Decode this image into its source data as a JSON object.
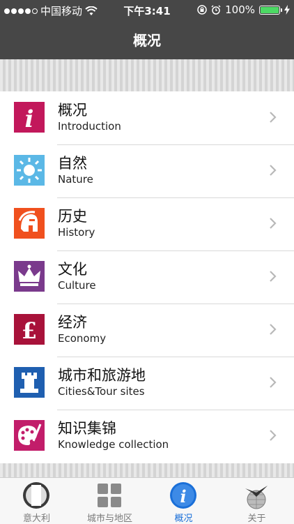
{
  "status_bar": {
    "carrier": "中国移动",
    "time": "下午3:41",
    "battery": "100%",
    "battery_level": 1.0
  },
  "nav": {
    "title": "概况"
  },
  "menu": {
    "items": [
      {
        "zh": "概况",
        "en": "Introduction",
        "icon": "info-icon",
        "color": "#c2185b"
      },
      {
        "zh": "自然",
        "en": "Nature",
        "icon": "sun-icon",
        "color": "#5bb8e6"
      },
      {
        "zh": "历史",
        "en": "History",
        "icon": "spartan-helmet-icon",
        "color": "#f0501e"
      },
      {
        "zh": "文化",
        "en": "Culture",
        "icon": "crown-icon",
        "color": "#7a3a8c"
      },
      {
        "zh": "经济",
        "en": "Economy",
        "icon": "pound-icon",
        "color": "#a8123a"
      },
      {
        "zh": "城市和旅游地",
        "en": "Cities&Tour sites",
        "icon": "castle-tower-icon",
        "color": "#1f5fb0"
      },
      {
        "zh": "知识集锦",
        "en": "Knowledge collection",
        "icon": "palette-icon",
        "color": "#c21d6a"
      }
    ]
  },
  "tabbar": {
    "tabs": [
      {
        "label": "意大利",
        "icon": "flag-icon"
      },
      {
        "label": "城市与地区",
        "icon": "grid-icon"
      },
      {
        "label": "概况",
        "icon": "info-icon",
        "active": true
      },
      {
        "label": "关于",
        "icon": "globe-bird-icon"
      }
    ]
  },
  "colors": {
    "nav_bg": "#474747",
    "active_tab": "#1a6fd8",
    "battery": "#4cd964"
  }
}
